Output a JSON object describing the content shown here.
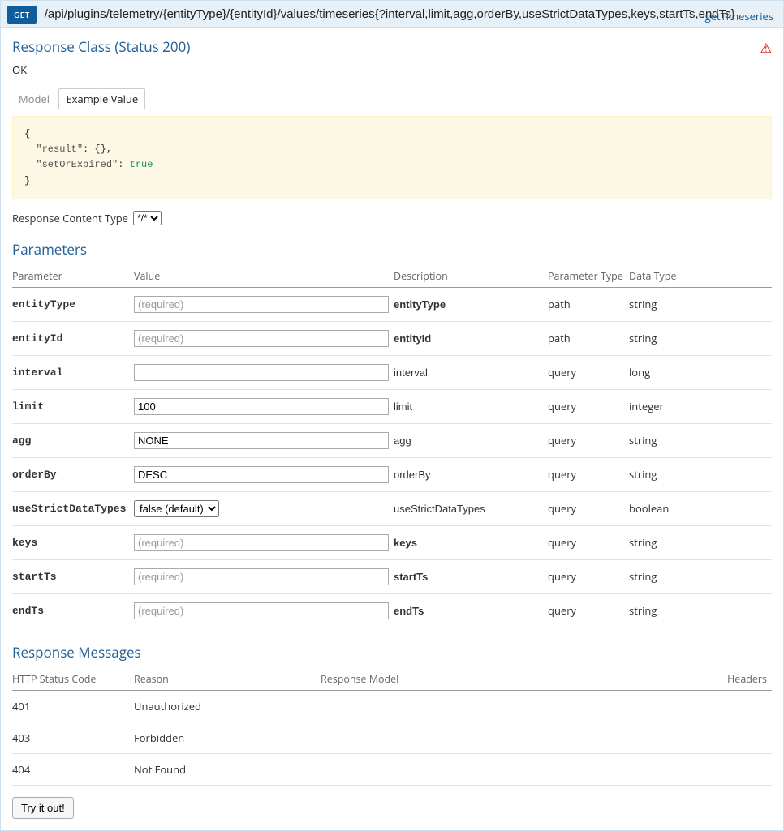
{
  "header": {
    "method": "GET",
    "path": "/api/plugins/telemetry/{entityType}/{entityId}/values/timeseries{?interval,limit,agg,orderBy,useStrictDataTypes,keys,startTs,endTs}",
    "nickname": "getTimeseries"
  },
  "response_class": {
    "heading": "Response Class (Status 200)",
    "status_text": "OK",
    "tabs": {
      "model": "Model",
      "example": "Example Value"
    },
    "example_json_lines": [
      {
        "text": "{"
      },
      {
        "indent": 1,
        "key": "\"result\"",
        "sep": ": ",
        "val": "{}",
        "tail": ","
      },
      {
        "indent": 1,
        "key": "\"setOrExpired\"",
        "sep": ": ",
        "val": "true",
        "val_class": "bool"
      },
      {
        "text": "}"
      }
    ]
  },
  "response_content_type": {
    "label": "Response Content Type",
    "selected": "*/*",
    "options": [
      "*/*"
    ]
  },
  "parameters": {
    "heading": "Parameters",
    "columns": {
      "param": "Parameter",
      "value": "Value",
      "desc": "Description",
      "ptype": "Parameter Type",
      "dtype": "Data Type"
    },
    "required_placeholder": "(required)",
    "rows": [
      {
        "name": "entityType",
        "required": true,
        "input_type": "text",
        "value": "",
        "description": "entityType",
        "param_type": "path",
        "data_type": "string"
      },
      {
        "name": "entityId",
        "required": true,
        "input_type": "text",
        "value": "",
        "description": "entityId",
        "param_type": "path",
        "data_type": "string"
      },
      {
        "name": "interval",
        "required": false,
        "input_type": "text",
        "value": "",
        "description": "interval",
        "param_type": "query",
        "data_type": "long"
      },
      {
        "name": "limit",
        "required": false,
        "input_type": "text",
        "value": "100",
        "description": "limit",
        "param_type": "query",
        "data_type": "integer"
      },
      {
        "name": "agg",
        "required": false,
        "input_type": "text",
        "value": "NONE",
        "description": "agg",
        "param_type": "query",
        "data_type": "string"
      },
      {
        "name": "orderBy",
        "required": false,
        "input_type": "text",
        "value": "DESC",
        "description": "orderBy",
        "param_type": "query",
        "data_type": "string"
      },
      {
        "name": "useStrictDataTypes",
        "required": false,
        "input_type": "select",
        "value": "false (default)",
        "options": [
          "false (default)",
          "true"
        ],
        "description": "useStrictDataTypes",
        "param_type": "query",
        "data_type": "boolean"
      },
      {
        "name": "keys",
        "required": true,
        "input_type": "text",
        "value": "",
        "description": "keys",
        "param_type": "query",
        "data_type": "string"
      },
      {
        "name": "startTs",
        "required": true,
        "input_type": "text",
        "value": "",
        "description": "startTs",
        "param_type": "query",
        "data_type": "string"
      },
      {
        "name": "endTs",
        "required": true,
        "input_type": "text",
        "value": "",
        "description": "endTs",
        "param_type": "query",
        "data_type": "string"
      }
    ]
  },
  "response_messages": {
    "heading": "Response Messages",
    "columns": {
      "code": "HTTP Status Code",
      "reason": "Reason",
      "model": "Response Model",
      "headers": "Headers"
    },
    "rows": [
      {
        "code": "401",
        "reason": "Unauthorized"
      },
      {
        "code": "403",
        "reason": "Forbidden"
      },
      {
        "code": "404",
        "reason": "Not Found"
      }
    ]
  },
  "try_it": "Try it out!"
}
